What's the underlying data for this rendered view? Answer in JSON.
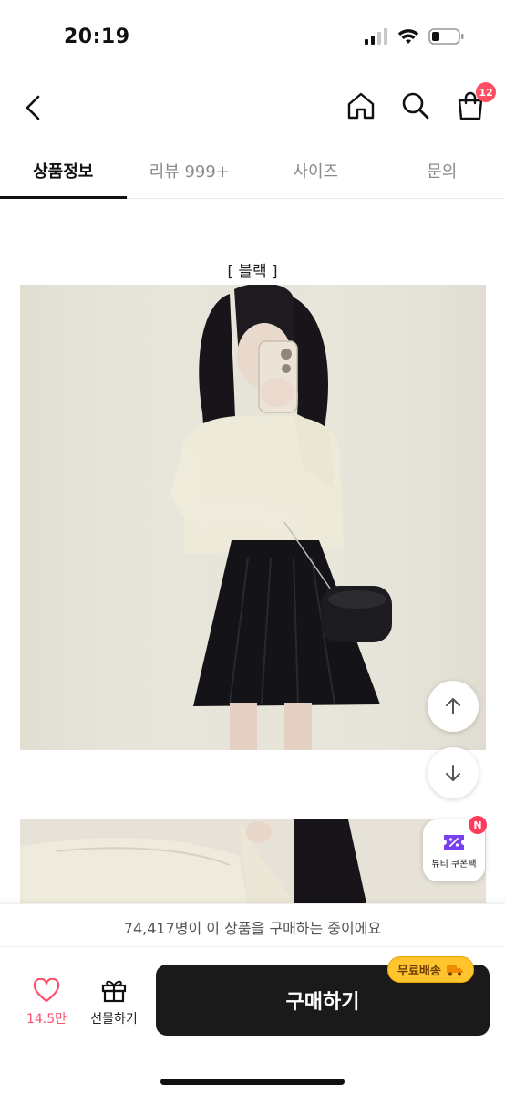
{
  "status": {
    "time": "20:19"
  },
  "header": {
    "cart_count": "12"
  },
  "tabs": [
    {
      "label": "상품정보"
    },
    {
      "label": "리뷰 999+"
    },
    {
      "label": "사이즈"
    },
    {
      "label": "문의"
    }
  ],
  "content": {
    "color_caption": "[ 블랙 ]"
  },
  "coupon": {
    "badge": "N",
    "label": "뷰티 쿠폰팩"
  },
  "purchase_notice": "74,417명이 이 상품을 구매하는 중이에요",
  "bottom": {
    "like_count": "14.5만",
    "gift_label": "선물하기",
    "buy_label": "구매하기",
    "shipping_badge": "무료배송"
  },
  "colors": {
    "accent": "#ff4f6d",
    "buy_button": "#1a1a1a",
    "shipping_badge": "#ffc42e"
  },
  "icons": [
    "back-icon",
    "home-icon",
    "search-icon",
    "cart-icon",
    "arrow-up-icon",
    "arrow-down-icon",
    "coupon-icon",
    "heart-icon",
    "gift-icon",
    "truck-icon"
  ]
}
